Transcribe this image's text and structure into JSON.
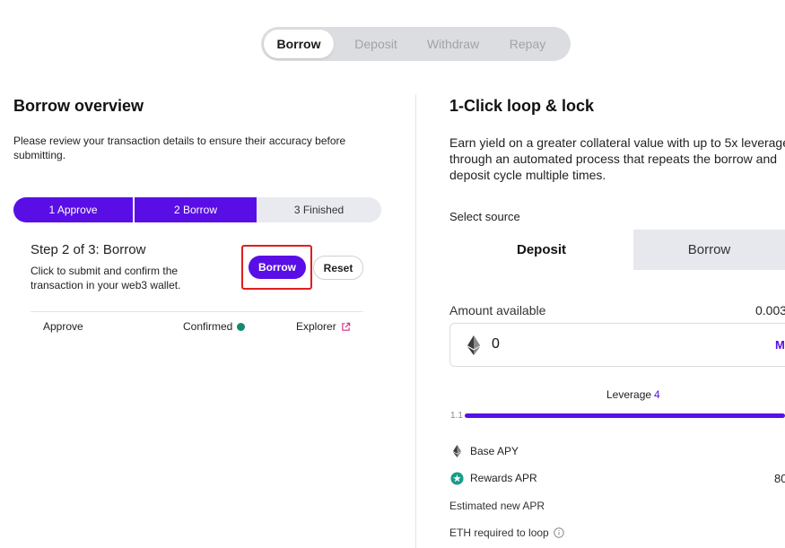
{
  "top_tabs": [
    {
      "label": "Borrow",
      "active": true
    },
    {
      "label": "Deposit",
      "active": false
    },
    {
      "label": "Withdraw",
      "active": false
    },
    {
      "label": "Repay",
      "active": false
    }
  ],
  "left": {
    "title": "Borrow overview",
    "description": "Please review your transaction details to ensure their accuracy before submitting.",
    "steps": [
      {
        "label": "1 Approve",
        "status": "done"
      },
      {
        "label": "2 Borrow",
        "status": "done"
      },
      {
        "label": "3 Finished",
        "status": "pending"
      }
    ],
    "step_title": "Step 2 of 3: Borrow",
    "step_description": "Click to submit and confirm the transaction in your web3 wallet.",
    "borrow_button": "Borrow",
    "reset_button": "Reset",
    "tx_row": {
      "name": "Approve",
      "status": "Confirmed",
      "status_color": "#128a6e",
      "link": "Explorer"
    }
  },
  "right": {
    "title": "1-Click loop & lock",
    "description_lines": [
      "Earn yield on a greater collateral value with up to 5x leverage",
      "through an automated process that repeats the borrow and",
      "deposit cycle multiple times."
    ],
    "select_source_label": "Select source",
    "source_tabs": [
      {
        "label": "Deposit",
        "active": true
      },
      {
        "label": "Borrow",
        "active": false
      }
    ],
    "amount_label": "Amount available",
    "amount_value": "0.003",
    "amount_input": "0",
    "max_label": "M",
    "leverage_label": "Leverage",
    "leverage_value": "4",
    "slider_min": "1.1",
    "base_apy_label": "Base APY",
    "rewards_apr_label": "Rewards APR",
    "rewards_apr_value": "80",
    "estimated_apr_label": "Estimated new APR",
    "eth_required_label": "ETH required to loop"
  },
  "colors": {
    "accent": "#5a0ee6",
    "highlight": "#e01e1e"
  },
  "icons": [
    "ethereum-icon",
    "rewards-star-icon",
    "external-link-icon",
    "info-icon"
  ]
}
